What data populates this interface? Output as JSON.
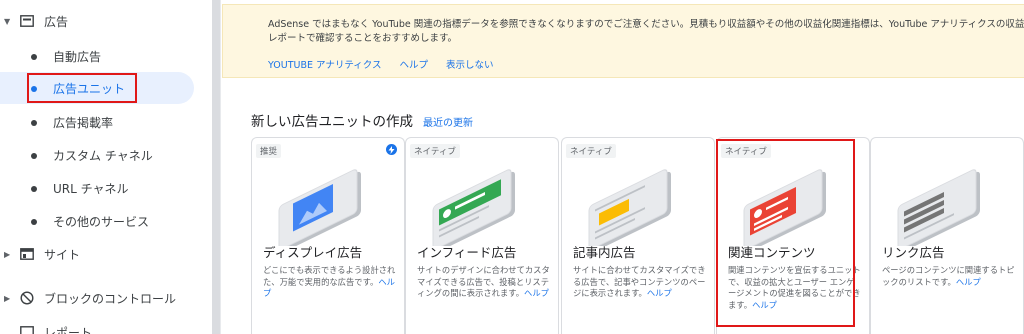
{
  "sidebar": {
    "ads_section": {
      "label": "広告"
    },
    "sub_items": [
      {
        "label": "自動広告"
      },
      {
        "label": "広告ユニット"
      },
      {
        "label": "広告掲載率"
      },
      {
        "label": "カスタム チャネル"
      },
      {
        "label": "URL チャネル"
      },
      {
        "label": "その他のサービス"
      }
    ],
    "sites_section": {
      "label": "サイト"
    },
    "blocking_section": {
      "label": "ブロックのコントロール"
    },
    "reports_section": {
      "label": "レポート"
    }
  },
  "banner": {
    "text": "AdSense ではまもなく YouTube 関連の指標データを参照できなくなりますのでご注意ください。見積もり収益額やその他の収益化関連指標は、YouTube アナリティクスの収益レポートで確認することをおすすめします。",
    "links": [
      "YOUTUBE アナリティクス",
      "ヘルプ",
      "表示しない"
    ]
  },
  "heading": {
    "title": "新しい広告ユニットの作成",
    "link": "最近の更新"
  },
  "cards": [
    {
      "badge": "推奨",
      "title": "ディスプレイ広告",
      "desc": "どこにでも表示できるよう設計された、万能で実用的な広告です。",
      "help": "ヘルプ",
      "accent": "#4285f4"
    },
    {
      "badge": "ネイティブ",
      "title": "インフィード広告",
      "desc": "サイトのデザインに合わせてカスタマイズできる広告で、投稿とリスティングの間に表示されます。",
      "help": "ヘルプ",
      "accent": "#34a853"
    },
    {
      "badge": "ネイティブ",
      "title": "記事内広告",
      "desc": "サイトに合わせてカスタマイズできる広告で、記事やコンテンツのページに表示されます。",
      "help": "ヘルプ",
      "accent": "#fbbc04"
    },
    {
      "badge": "ネイティブ",
      "title": "関連コンテンツ",
      "desc": "関連コンテンツを宣伝するユニットで、収益の拡大とユーザー エンゲージメントの促進を図ることができます。",
      "help": "ヘルプ",
      "accent": "#ea4335"
    },
    {
      "badge": "",
      "title": "リンク広告",
      "desc": "ページのコンテンツに関連するトピックのリストです。",
      "help": "ヘルプ",
      "accent": "#757575"
    }
  ],
  "colors": {
    "link": "#1a73e8",
    "highlight": "#e01818",
    "banner_bg": "#fef7e0"
  }
}
